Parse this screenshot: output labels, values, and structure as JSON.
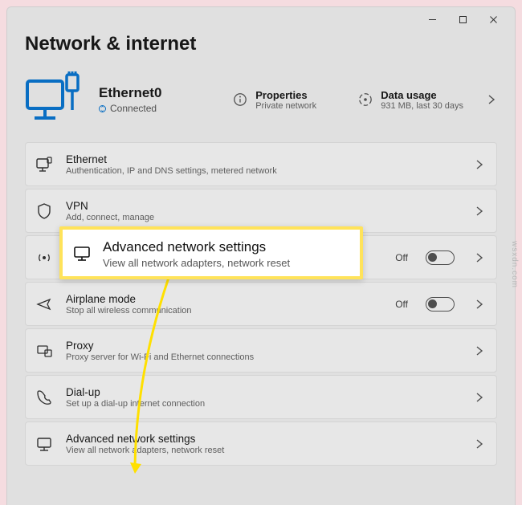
{
  "page_title": "Network & internet",
  "status": {
    "name": "Ethernet0",
    "state": "Connected"
  },
  "info_cards": {
    "properties": {
      "title": "Properties",
      "subtitle": "Private network"
    },
    "data_usage": {
      "title": "Data usage",
      "subtitle": "931 MB, last 30 days"
    }
  },
  "rows": {
    "ethernet": {
      "title": "Ethernet",
      "subtitle": "Authentication, IP and DNS settings, metered network"
    },
    "vpn": {
      "title": "VPN",
      "subtitle": "Add, connect, manage"
    },
    "hotspot": {
      "title": "",
      "subtitle": "",
      "toggle_label": "Off"
    },
    "airplane": {
      "title": "Airplane mode",
      "subtitle": "Stop all wireless communication",
      "toggle_label": "Off"
    },
    "proxy": {
      "title": "Proxy",
      "subtitle": "Proxy server for Wi-Fi and Ethernet connections"
    },
    "dialup": {
      "title": "Dial-up",
      "subtitle": "Set up a dial-up internet connection"
    },
    "advanced": {
      "title": "Advanced network settings",
      "subtitle": "View all network adapters, network reset"
    }
  },
  "highlight": {
    "title": "Advanced network settings",
    "subtitle": "View all network adapters, network reset"
  },
  "watermark": "wsxdn.com"
}
